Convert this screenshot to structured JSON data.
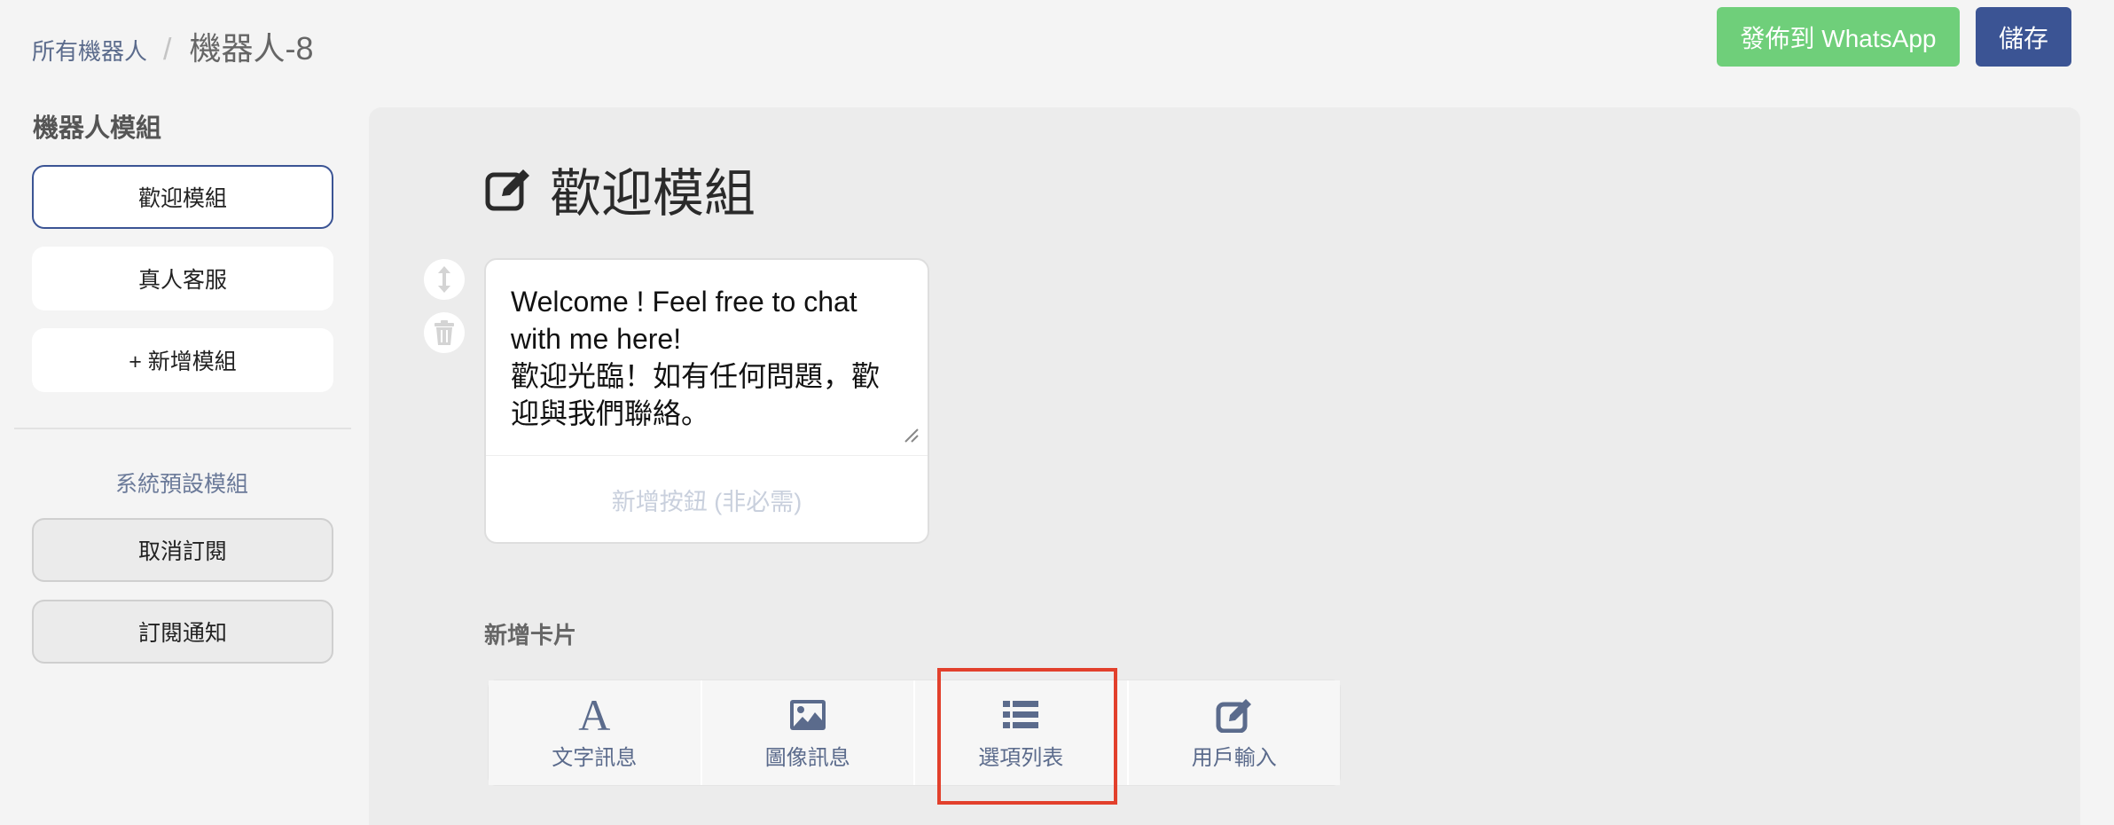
{
  "header": {
    "breadcrumb_root": "所有機器人",
    "breadcrumb_sep": "/",
    "breadcrumb_current": "機器人-8",
    "publish_label": "發佈到 WhatsApp",
    "save_label": "儲存",
    "colors": {
      "publish": "#6fcf7a",
      "save": "#3b5494"
    }
  },
  "sidebar": {
    "title": "機器人模組",
    "modules": [
      {
        "label": "歡迎模組",
        "active": true
      },
      {
        "label": "真人客服",
        "active": false
      },
      {
        "label": "+ 新增模組",
        "active": false
      }
    ],
    "system_title": "系統預設模組",
    "system_modules": [
      {
        "label": "取消訂閱"
      },
      {
        "label": "訂閱通知"
      }
    ]
  },
  "main": {
    "edit_icon": "edit-icon",
    "module_title": "歡迎模組",
    "controls": [
      "move-vertical-icon",
      "trash-icon"
    ],
    "message_card": {
      "text": "Welcome ! Feel free to chat with me here!\n歡迎光臨！如有任何問題，歡迎與我們聯絡。",
      "add_button_placeholder": "新增按鈕 (非必需)"
    },
    "add_card_label": "新增卡片",
    "card_types": [
      {
        "label": "文字訊息",
        "icon": "text-icon"
      },
      {
        "label": "圖像訊息",
        "icon": "image-icon"
      },
      {
        "label": "選項列表",
        "icon": "list-icon"
      },
      {
        "label": "用戶輸入",
        "icon": "user-input-icon"
      }
    ],
    "highlight_color": "#e2402c"
  }
}
